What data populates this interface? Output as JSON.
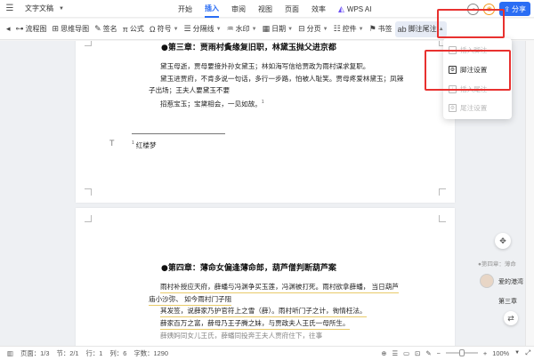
{
  "app": {
    "file_menu": "文字文稿"
  },
  "tabs": [
    {
      "label": "开始",
      "active": false
    },
    {
      "label": "插入",
      "active": true
    },
    {
      "label": "审阅",
      "active": false
    },
    {
      "label": "视图",
      "active": false
    },
    {
      "label": "页面",
      "active": false
    },
    {
      "label": "效率",
      "active": false
    }
  ],
  "wps_ai": "WPS AI",
  "share_label": "分享",
  "toolbar": {
    "items": [
      {
        "label": "流程图",
        "icon": "flowchart-icon"
      },
      {
        "label": "思维导图",
        "icon": "mindmap-icon"
      },
      {
        "label": "签名",
        "icon": "signature-icon"
      },
      {
        "label": "公式",
        "icon": "formula-icon"
      },
      {
        "label": "符号",
        "icon": "symbol-icon"
      },
      {
        "label": "分隔线",
        "icon": "divider-icon"
      },
      {
        "label": "水印",
        "icon": "watermark-icon"
      },
      {
        "label": "日期",
        "icon": "date-icon"
      },
      {
        "label": "分页",
        "icon": "pagebreak-icon"
      },
      {
        "label": "控件",
        "icon": "control-icon"
      },
      {
        "label": "书签",
        "icon": "bookmark-icon"
      },
      {
        "label": "脚注尾注",
        "icon": "footnote-icon"
      }
    ]
  },
  "dropdown": {
    "items": [
      {
        "label": "插入脚注",
        "enabled": false
      },
      {
        "label": "脚注设置",
        "enabled": true
      },
      {
        "label": "插入尾注",
        "enabled": false
      },
      {
        "label": "尾注设置",
        "enabled": false
      }
    ]
  },
  "page1": {
    "title": "●第三章：贾雨村夤缘复旧职，林黛玉抛父进京都",
    "paragraphs": [
      "黛玉母逝，贾母要接外孙女黛玉；林如海写信给贾政为雨村谋求复职。",
      "黛玉进贾府，不肯多说一句话，多行一步路，怕被人耻笑。贾母疼爱林黛玉；凤辣",
      "子出场；王夫人要黛玉不要",
      "招惹宝玉；宝黛相会，一见如故。"
    ],
    "footnote_ref": "1",
    "footnote_num": "1",
    "footnote_text": "红楼梦"
  },
  "page2": {
    "title": "●第四章：薄命女偏逢薄命郎，葫芦僧判断葫芦案",
    "lines": [
      "雨村补授应天府，薛蟠与冯渊争买玉莲，冯渊被打死。雨村欲拿薛蟠，  当日葫芦",
      "庙小沙弥、  如今雨村门子阻",
      "其发签，说薛家乃护官符上之雪（薛）。雨村听门子之计，徇情枉法。",
      "薛家百万之富，薛母乃王子腾之妹，与贾政夫人王氏一母所生。",
      "薛姨妈同女儿王氏，薛蟠同投奔王夫人贾府住下，往事"
    ]
  },
  "comment": {
    "header": "●第四章：薄命",
    "user": "爱的港湾",
    "ref": "第三章"
  },
  "status": {
    "page": "页面：1/3",
    "section": "节：2/1",
    "row": "行：1",
    "col": "列：6",
    "words": "字数：1290",
    "zoom": "100%"
  }
}
